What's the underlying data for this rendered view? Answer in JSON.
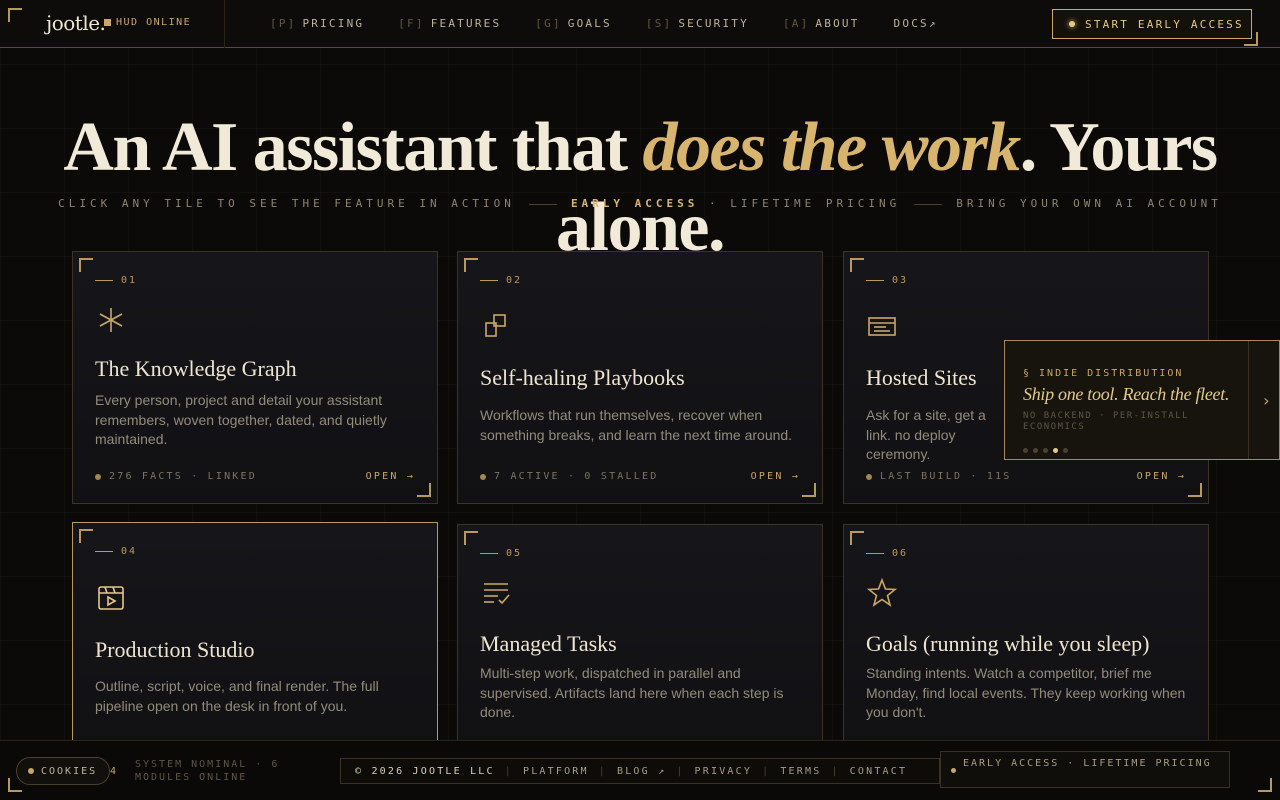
{
  "nav": {
    "logo": "jootle.",
    "hud": "HUD ONLINE",
    "links": [
      {
        "key": "[P]",
        "label": "PRICING"
      },
      {
        "key": "[F]",
        "label": "FEATURES"
      },
      {
        "key": "[G]",
        "label": "GOALS"
      },
      {
        "key": "[S]",
        "label": "SECURITY"
      },
      {
        "key": "[A]",
        "label": "ABOUT"
      },
      {
        "key": "",
        "label": "DOCS↗"
      }
    ],
    "cta": "START EARLY ACCESS"
  },
  "hero": {
    "title_before": "An AI assistant that ",
    "title_accent": "does the work",
    "title_after": ". Yours alone.",
    "sub_left": "CLICK ANY TILE TO SEE THE FEATURE IN ACTION",
    "sub_highlight": "EARLY ACCESS",
    "sub_mid": " · LIFETIME PRICING",
    "sub_right": "BRING YOUR OWN AI ACCOUNT"
  },
  "tiles": [
    {
      "num": "01",
      "icon": "asterisk-icon",
      "title": "The Knowledge Graph",
      "desc": "Every person, project and detail your assistant remembers, woven together, dated, and quietly maintained.",
      "stat": "276 FACTS · LINKED",
      "open": "OPEN →"
    },
    {
      "num": "02",
      "icon": "blocks-icon",
      "title": "Self-healing Playbooks",
      "desc": "Workflows that run themselves, recover when something breaks, and learn the next time around.",
      "stat": "7 ACTIVE · 0 STALLED",
      "open": "OPEN →"
    },
    {
      "num": "03",
      "icon": "browser-card-icon",
      "title": "Hosted Sites",
      "desc": "Ask for a site, get a link. no deploy ceremony.",
      "stat": "LAST BUILD · 11S",
      "open": "OPEN →"
    },
    {
      "num": "04",
      "icon": "video-frame-icon",
      "title": "Production Studio",
      "desc": "Outline, script, voice, and final render. The full pipeline open on the desk in front of you.",
      "stat": "",
      "open": ""
    },
    {
      "num": "05",
      "icon": "task-list-icon",
      "title": "Managed Tasks",
      "desc": "Multi-step work, dispatched in parallel and supervised. Artifacts land here when each step is done.",
      "stat": "",
      "open": ""
    },
    {
      "num": "06",
      "icon": "star-icon",
      "title": "Goals (running while you sleep)",
      "desc": "Standing intents. Watch a competitor, brief me Monday, find local events. They keep working when you don't.",
      "stat": "",
      "open": ""
    }
  ],
  "promo": {
    "label": "§ INDIE DISTRIBUTION",
    "title": "Ship one tool. Reach the fleet.",
    "meta": "NO BACKEND · PER-INSTALL ECONOMICS",
    "active_slide": 4,
    "slide_count": 5
  },
  "footer": {
    "cookies": "COOKIES",
    "num": "4",
    "system": "SYSTEM NOMINAL · 6 MODULES ONLINE",
    "copyright": "© 2026 JOOTLE LLC",
    "links": [
      "PLATFORM",
      "BLOG ↗",
      "PRIVACY",
      "TERMS",
      "CONTACT"
    ],
    "early": "EARLY ACCESS · LIFETIME PRICING"
  },
  "colors": {
    "accent": "#d8b56e",
    "background": "#0b0a08",
    "border": "#3a3426"
  }
}
